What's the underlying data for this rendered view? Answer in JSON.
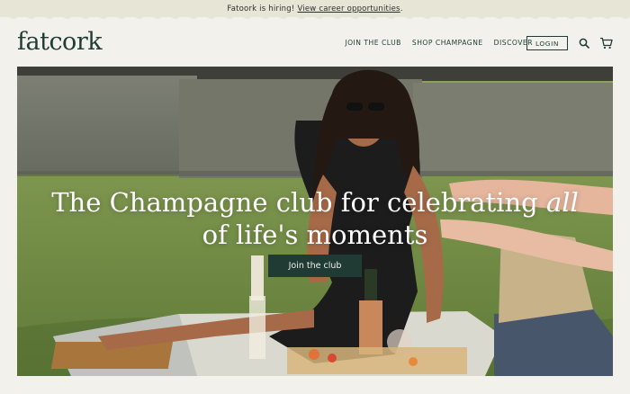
{
  "announcement": {
    "text": "Fatoork is hiring!",
    "link": "View career opportunities",
    "suffix": "."
  },
  "header": {
    "logo": "fatcork",
    "nav": [
      "JOIN THE CLUB",
      "SHOP CHAMPAGNE",
      "DISCOVER"
    ],
    "login": "LOGIN",
    "icons": [
      "search-icon",
      "cart-icon"
    ]
  },
  "hero": {
    "headline_line1_pre": "The Champagne club for celebrating ",
    "headline_line1_em": "all",
    "headline_line2": "of life's moments",
    "cta": "Join the club"
  },
  "colors": {
    "brand_green": "#1f3b33",
    "page_bg": "#f2f1ec",
    "announce_bg": "#e7e6d6"
  }
}
